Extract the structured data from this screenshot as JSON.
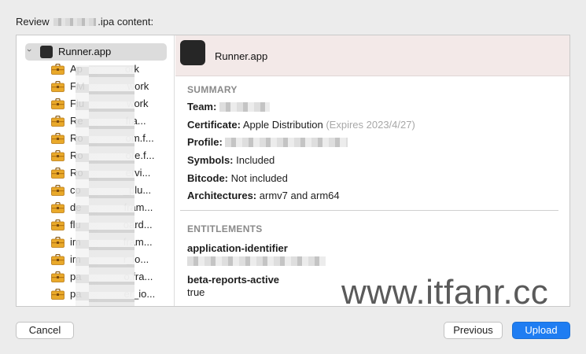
{
  "window": {
    "heading_prefix": "Review",
    "heading_suffix": ".ipa content:"
  },
  "sidebar": {
    "root": {
      "label": "Runner.app",
      "icon": "app-icon"
    },
    "items": [
      {
        "label": "Ap",
        "tail": "ork"
      },
      {
        "label": "FM",
        "tail": "work"
      },
      {
        "label": "Flu",
        "tail": "work"
      },
      {
        "label": "Re",
        "tail": "fra..."
      },
      {
        "label": "Ro",
        "tail": "om.f..."
      },
      {
        "label": "Ro",
        "tail": "ore.f..."
      },
      {
        "label": "Ro",
        "tail": "ervi..."
      },
      {
        "label": "co",
        "tail": "_plu..."
      },
      {
        "label": "de",
        "tail": "fram..."
      },
      {
        "label": "flu",
        "tail": "oard..."
      },
      {
        "label": "im",
        "tail": "fram..."
      },
      {
        "label": "im",
        "tail": "r_io..."
      },
      {
        "label": "pa",
        "tail": "o.fra..."
      },
      {
        "label": "pa",
        "tail": "er_io..."
      }
    ]
  },
  "detail": {
    "title": "Runner.app",
    "summary_heading": "SUMMARY",
    "team_key": "Team:",
    "certificate_key": "Certificate:",
    "certificate_value": "Apple Distribution",
    "certificate_note": "(Expires 2023/4/27)",
    "profile_key": "Profile:",
    "symbols_key": "Symbols:",
    "symbols_value": "Included",
    "bitcode_key": "Bitcode:",
    "bitcode_value": "Not included",
    "arch_key": "Architectures:",
    "arch_value": "armv7 and arm64",
    "entitlements_heading": "ENTITLEMENTS",
    "ent1_key": "application-identifier",
    "ent2_key": "beta-reports-active",
    "ent2_value": "true"
  },
  "buttons": {
    "cancel": "Cancel",
    "previous": "Previous",
    "upload": "Upload"
  },
  "watermark": "www.itfanr.cc",
  "colors": {
    "accent": "#1f7df2",
    "header_tint": "#f3e9e8"
  }
}
